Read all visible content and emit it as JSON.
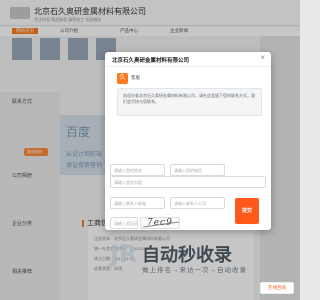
{
  "header": {
    "site_title": "北京石久奥研金属材料有限公司",
    "site_subtitle": "专注研发 铸造锻造 精密加工 优质服务"
  },
  "nav": {
    "items": [
      "网站首页",
      "公司介绍",
      "产品中心",
      "企业新闻"
    ]
  },
  "left": {
    "contact_label": "联系方式",
    "mail_label": "发送询价",
    "category_label": "公司相册",
    "type_label": "企业分类",
    "related_label": "相关推荐"
  },
  "ad": {
    "big": "百度",
    "line1": "从设计到前端",
    "line2": "保证搜索营销"
  },
  "info": {
    "heading": "工商信息",
    "rows": [
      "注册资本：北京石久奥研金属材料有限公司",
      "统一社会信用代码：91110108",
      "成立日期：2017-01-03",
      "经营状态：存续"
    ]
  },
  "modal": {
    "title": "北京石久奥研金属材料有限公司",
    "close": "×",
    "avatar": "久",
    "sender": "客服",
    "message": "欢迎光临北京石久奥研金属材料有限公司，请在这里留下您的联系方式，我们会尽快与您联系。",
    "fields": {
      "name_placeholder": "请输入您的姓名",
      "phone_placeholder": "请输入您的电话",
      "message_placeholder": "请输入留言内容",
      "email_placeholder": "请输入联系人邮箱",
      "company_placeholder": "请输入联系人公司",
      "captcha_placeholder": "请输入验证码"
    },
    "captcha_text": "7ec9",
    "submit": "提交"
  },
  "watermark": {
    "logo": "JR",
    "text": "自动秒收录",
    "sub": "做上排名→来访一次→自动收录"
  },
  "float": {
    "label": "在线咨询"
  },
  "colors": {
    "accent": "#ff7a1a",
    "submit": "#ff5a1a"
  }
}
